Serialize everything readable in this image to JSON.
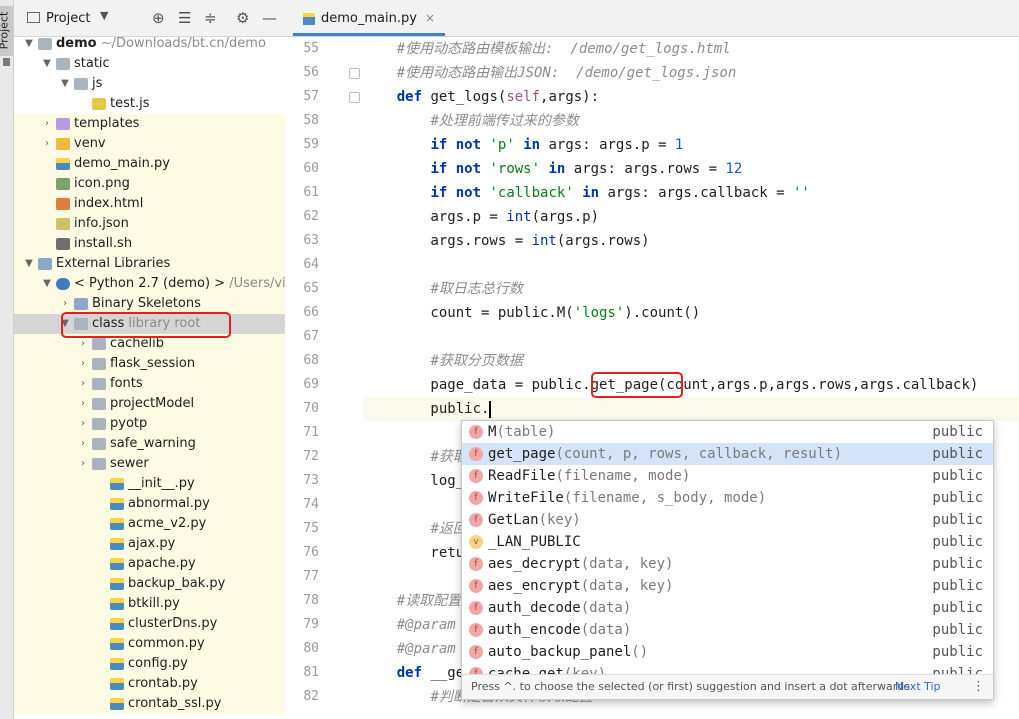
{
  "toolwindow": {
    "label": "Project"
  },
  "project_panel": {
    "title": "Project",
    "tree": [
      {
        "label": "demo",
        "extra": "~/Downloads/bt.cn/demo",
        "icon": "folder-icon",
        "arrow": "▼",
        "bold": true
      },
      {
        "label": "static",
        "icon": "folder-icon",
        "arrow": "▼"
      },
      {
        "label": "js",
        "icon": "folder-icon",
        "arrow": "▼"
      },
      {
        "label": "test.js",
        "icon": "js-file-icon"
      },
      {
        "label": "templates",
        "icon": "template-folder-icon",
        "arrow": "›"
      },
      {
        "label": "venv",
        "icon": "venv-folder-icon",
        "arrow": "›"
      },
      {
        "label": "demo_main.py",
        "icon": "python-file-icon"
      },
      {
        "label": "icon.png",
        "icon": "image-file-icon"
      },
      {
        "label": "index.html",
        "icon": "html-file-icon"
      },
      {
        "label": "info.json",
        "icon": "json-file-icon"
      },
      {
        "label": "install.sh",
        "icon": "shell-file-icon"
      },
      {
        "label": "External Libraries",
        "icon": "library-icon",
        "arrow": "▼"
      },
      {
        "label": "< Python 2.7 (demo) >",
        "extra": "/Users/vide",
        "icon": "python-sdk-icon",
        "arrow": "▼"
      },
      {
        "label": "Binary Skeletons",
        "icon": "library-icon",
        "arrow": "›"
      },
      {
        "label": "class",
        "extra": "library root",
        "icon": "folder-icon",
        "arrow": "▼"
      },
      {
        "label": "cachelib",
        "icon": "folder-icon",
        "arrow": "›"
      },
      {
        "label": "flask_session",
        "icon": "folder-icon",
        "arrow": "›"
      },
      {
        "label": "fonts",
        "icon": "folder-icon",
        "arrow": "›"
      },
      {
        "label": "projectModel",
        "icon": "folder-icon",
        "arrow": "›"
      },
      {
        "label": "pyotp",
        "icon": "folder-icon",
        "arrow": "›"
      },
      {
        "label": "safe_warning",
        "icon": "folder-icon",
        "arrow": "›"
      },
      {
        "label": "sewer",
        "icon": "folder-icon",
        "arrow": "›"
      },
      {
        "label": "__init__.py",
        "icon": "python-file-icon"
      },
      {
        "label": "abnormal.py",
        "icon": "python-file-icon"
      },
      {
        "label": "acme_v2.py",
        "icon": "python-file-icon"
      },
      {
        "label": "ajax.py",
        "icon": "python-file-icon"
      },
      {
        "label": "apache.py",
        "icon": "python-file-icon"
      },
      {
        "label": "backup_bak.py",
        "icon": "python-file-icon"
      },
      {
        "label": "btkill.py",
        "icon": "python-file-icon"
      },
      {
        "label": "clusterDns.py",
        "icon": "python-file-icon"
      },
      {
        "label": "common.py",
        "icon": "python-file-icon"
      },
      {
        "label": "config.py",
        "icon": "python-file-icon"
      },
      {
        "label": "crontab.py",
        "icon": "python-file-icon"
      },
      {
        "label": "crontab_ssl.py",
        "icon": "python-file-icon"
      }
    ]
  },
  "editor": {
    "tab": {
      "label": "demo_main.py",
      "close": "×"
    },
    "line_numbers": [
      "55",
      "56",
      "57",
      "58",
      "59",
      "60",
      "61",
      "62",
      "63",
      "64",
      "65",
      "66",
      "67",
      "68",
      "69",
      "70",
      "71",
      "72",
      "73",
      "74",
      "75",
      "76",
      "77",
      "78",
      "79",
      "80",
      "81",
      "82"
    ],
    "lines": [
      "    #使用动态路由模板输出:  /demo/get_logs.html",
      "    #使用动态路由输出JSON:  /demo/get_logs.json",
      "    def get_logs(self,args):",
      "        #处理前端传过来的参数",
      "        if not 'p' in args: args.p = 1",
      "        if not 'rows' in args: args.rows = 12",
      "        if not 'callback' in args: args.callback = ''",
      "        args.p = int(args.p)",
      "        args.rows = int(args.rows)",
      "",
      "        #取日志总行数",
      "        count = public.M('logs').count()",
      "",
      "        #获取分页数据",
      "        page_data = public.get_page(count,args.p,args.rows,args.callback)",
      "        public.",
      "",
      "        #获取",
      "        log_",
      "",
      "        #返回",
      "        retu",
      "",
      "    #读取配置",
      "    #@param",
      "    #@param",
      "    def __ge",
      "        #判断是否从文件读取配置"
    ]
  },
  "completion": {
    "items": [
      {
        "name": "M",
        "sig": "(table)",
        "type": "public",
        "kind": "f"
      },
      {
        "name": "get_page",
        "sig": "(count, p, rows, callback, result)",
        "type": "public",
        "kind": "f",
        "selected": true
      },
      {
        "name": "ReadFile",
        "sig": "(filename, mode)",
        "type": "public",
        "kind": "f"
      },
      {
        "name": "WriteFile",
        "sig": "(filename, s_body, mode)",
        "type": "public",
        "kind": "f"
      },
      {
        "name": "GetLan",
        "sig": "(key)",
        "type": "public",
        "kind": "f"
      },
      {
        "name": "_LAN_PUBLIC",
        "sig": "",
        "type": "public",
        "kind": "v"
      },
      {
        "name": "aes_decrypt",
        "sig": "(data, key)",
        "type": "public",
        "kind": "f"
      },
      {
        "name": "aes_encrypt",
        "sig": "(data, key)",
        "type": "public",
        "kind": "f"
      },
      {
        "name": "auth_decode",
        "sig": "(data)",
        "type": "public",
        "kind": "f"
      },
      {
        "name": "auth_encode",
        "sig": "(data)",
        "type": "public",
        "kind": "f"
      },
      {
        "name": "auto_backup_panel",
        "sig": "()",
        "type": "public",
        "kind": "f"
      },
      {
        "name": "cache_get",
        "sig": "(key)",
        "type": "public",
        "kind": "f"
      }
    ],
    "footer_hint": "Press ^. to choose the selected (or first) suggestion and insert a dot afterwards",
    "next_tip": "Next Tip",
    "menu": "⋮"
  },
  "colors": {
    "keyword": "#0033b3",
    "string": "#067d17",
    "comment": "#8c8c8c",
    "number": "#1750eb",
    "highlight_box": "#e3211b",
    "selection": "#d4e2fa"
  }
}
